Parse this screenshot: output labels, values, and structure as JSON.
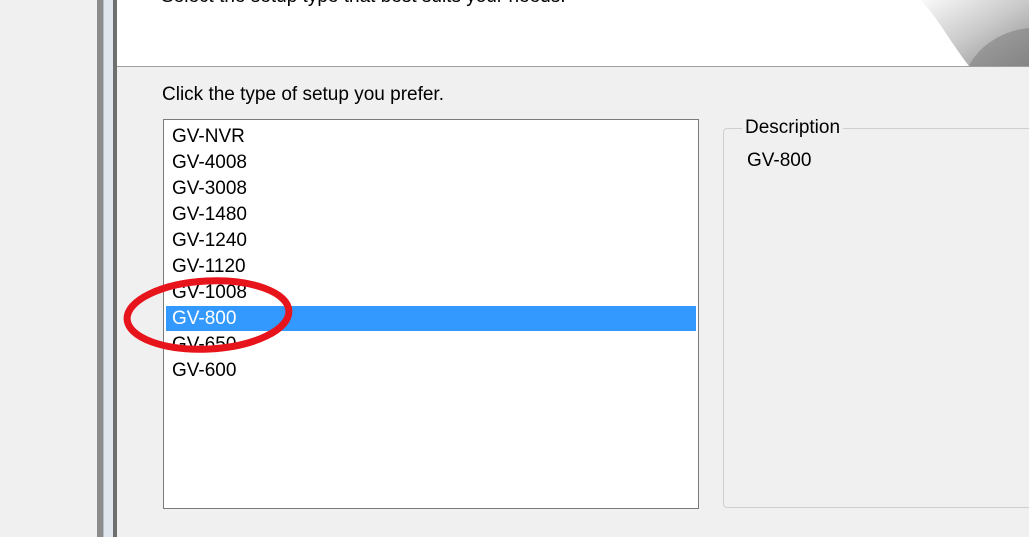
{
  "header": {
    "subtitle": "Select the setup type that best suits your needs."
  },
  "prompt": "Click the type of setup you prefer.",
  "setup_types": [
    {
      "label": "GV-NVR",
      "selected": false
    },
    {
      "label": "GV-4008",
      "selected": false
    },
    {
      "label": "GV-3008",
      "selected": false
    },
    {
      "label": "GV-1480",
      "selected": false
    },
    {
      "label": "GV-1240",
      "selected": false
    },
    {
      "label": "GV-1120",
      "selected": false
    },
    {
      "label": "GV-1008",
      "selected": false
    },
    {
      "label": "GV-800",
      "selected": true
    },
    {
      "label": "GV-650",
      "selected": false
    },
    {
      "label": "GV-600",
      "selected": false
    }
  ],
  "description": {
    "legend": "Description",
    "text": "GV-800"
  },
  "colors": {
    "selection": "#3399ff",
    "annotation_circle": "#e8141b"
  }
}
